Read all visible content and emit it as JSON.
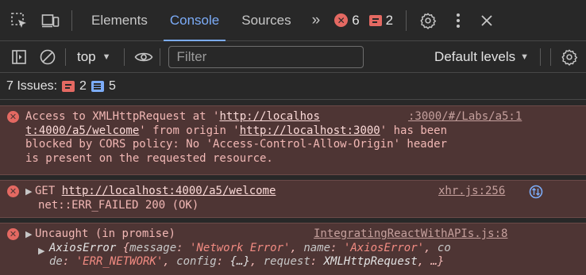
{
  "tabs": {
    "items": [
      "Elements",
      "Console",
      "Sources"
    ],
    "active": "Console",
    "more": "»",
    "error_count": "6",
    "issue_count": "2"
  },
  "toolbar": {
    "context": "top",
    "filter_placeholder": "Filter",
    "levels": "Default levels"
  },
  "issues": {
    "label": "7 Issues:",
    "error_count": "2",
    "info_count": "5"
  },
  "messages": {
    "m1": {
      "prefix": "Access to XMLHttpRequest at '",
      "url_part1": "http://localhos",
      "source": ":3000/#/Labs/a5:1",
      "url_part2": "t:4000/a5/welcome",
      "mid1": "' from origin '",
      "origin": "http://localhost:3000",
      "mid2": "' has been",
      "line3": "blocked by CORS policy: No 'Access-Control-Allow-Origin' header",
      "line4": "is present on the requested resource."
    },
    "m2": {
      "method": "GET ",
      "url": "http://localhost:4000/a5/welcome",
      "source": "xhr.js:256",
      "status": "net::ERR_FAILED 200 (OK)"
    },
    "m3": {
      "text": "Uncaught (in promise)",
      "source": "IntegratingReactWithAPIs.js:8",
      "obj_name": "AxiosError",
      "k_message": "message",
      "v_message": "'Network Error'",
      "k_name": "name",
      "v_name": "'AxiosError'",
      "k_code_a": "co",
      "k_code_b": "de",
      "v_code": "'ERR_NETWORK'",
      "k_config": "config",
      "v_config": "{…}",
      "k_request": "request",
      "v_request": "XMLHttpRequest",
      "tail": "…}"
    }
  },
  "colors": {
    "accent": "#7cacf8",
    "error": "#e46962",
    "error_bg": "#4e3534"
  }
}
